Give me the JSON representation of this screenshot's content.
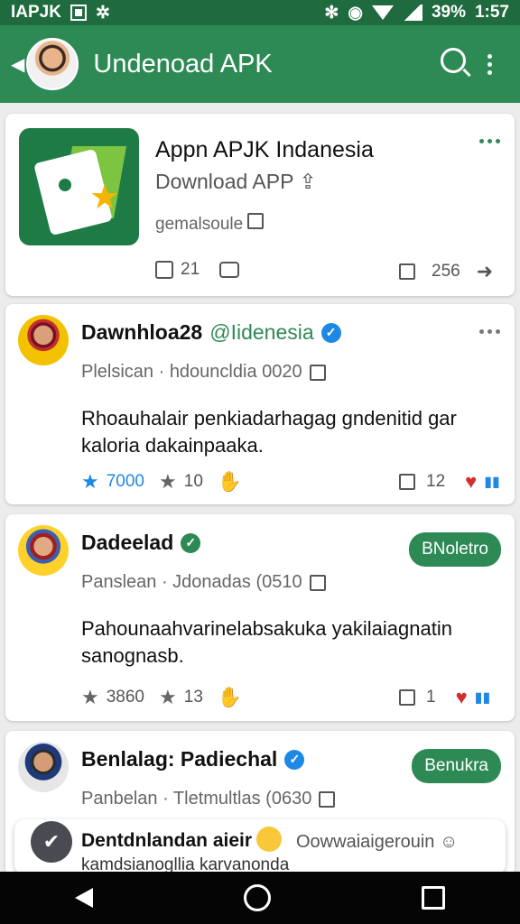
{
  "status": {
    "left_text": "IAPJK",
    "battery": "39%",
    "time": "1:57"
  },
  "appbar": {
    "title": "Undenoad APK",
    "icons": [
      "back-arrow-icon",
      "search-icon",
      "more-vert-icon"
    ]
  },
  "app_card": {
    "title": "Appn APJK Indanesia",
    "subtitle": "Download APP",
    "developer": "gemalsoule",
    "likes": "21",
    "shares": "256"
  },
  "posts": [
    {
      "name": "Dawnhloa28",
      "handle": "@Iidenesia",
      "meta": "Plelsican · hdouncldia 0020",
      "body": "Rhoauhalair penkiadarhagag gndenitid gar kaloria dakainpaaka.",
      "stat1": "7000",
      "stat2": "10",
      "comments": "12"
    },
    {
      "name": "Dadeelad",
      "button": "BNoletro",
      "meta": "Panslean · Jdonadas (0510",
      "body": "Pahounaahvarinelabsakuka yakilaiagnatin sanognasb.",
      "stat1": "3860",
      "stat2": "13",
      "comments": "1"
    },
    {
      "name": "Benlalag: Padiechal",
      "button": "Benukra",
      "meta": "Panbelan · Tletmultlas (0630"
    }
  ],
  "notification": {
    "title": "Dentdnlandan aieir",
    "right": "Oowwaiaigerouin",
    "bottom": "kamdsianogllia karvanonda"
  },
  "colors": {
    "primary": "#2e8a55",
    "status_bar": "#1f6b3f",
    "accent_blue": "#1e88e5"
  }
}
